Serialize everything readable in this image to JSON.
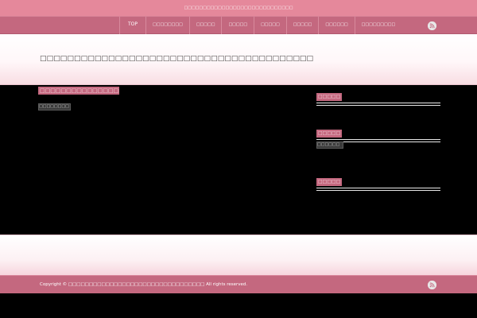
{
  "banner": {
    "text": "□□□□□□□□□□□□□□□□□□□□□□□□□□□□□"
  },
  "nav": {
    "items": [
      {
        "label": "TOP"
      },
      {
        "label": "□□□□□□□□"
      },
      {
        "label": "□□□□□"
      },
      {
        "label": "□□□□□"
      },
      {
        "label": "□□□□□"
      },
      {
        "label": "□□□□□"
      },
      {
        "label": "□□□□□□"
      },
      {
        "label": "□□□□□□□□□"
      }
    ],
    "rss_icon": "rss-icon"
  },
  "header": {
    "site_title": "□□□□□□□□□□□□□□□□□□□□□□□□□□□□□□□□□□□□□□□□"
  },
  "main": {
    "post_title": "□□□□□□□□□□□□□□□□",
    "post_meta": "□□□□□□□□"
  },
  "sidebar": {
    "widgets": [
      {
        "heading": "□□□□□"
      },
      {
        "heading": "□□□□□",
        "box_text": "□□□□□□"
      },
      {
        "heading": "□□□□□"
      }
    ]
  },
  "footer": {
    "copyright_prefix": "Copyright ©",
    "site_name": "□□□□□□□□□□□□□□□□□□□□□□□□□□□□□□□□□",
    "copyright_suffix": "All rights reserved.",
    "rss_icon": "rss-icon"
  },
  "colors": {
    "banner": "#e5889b",
    "nav": "#c4687f",
    "accent": "#c4687f",
    "main_bg": "#000000"
  }
}
